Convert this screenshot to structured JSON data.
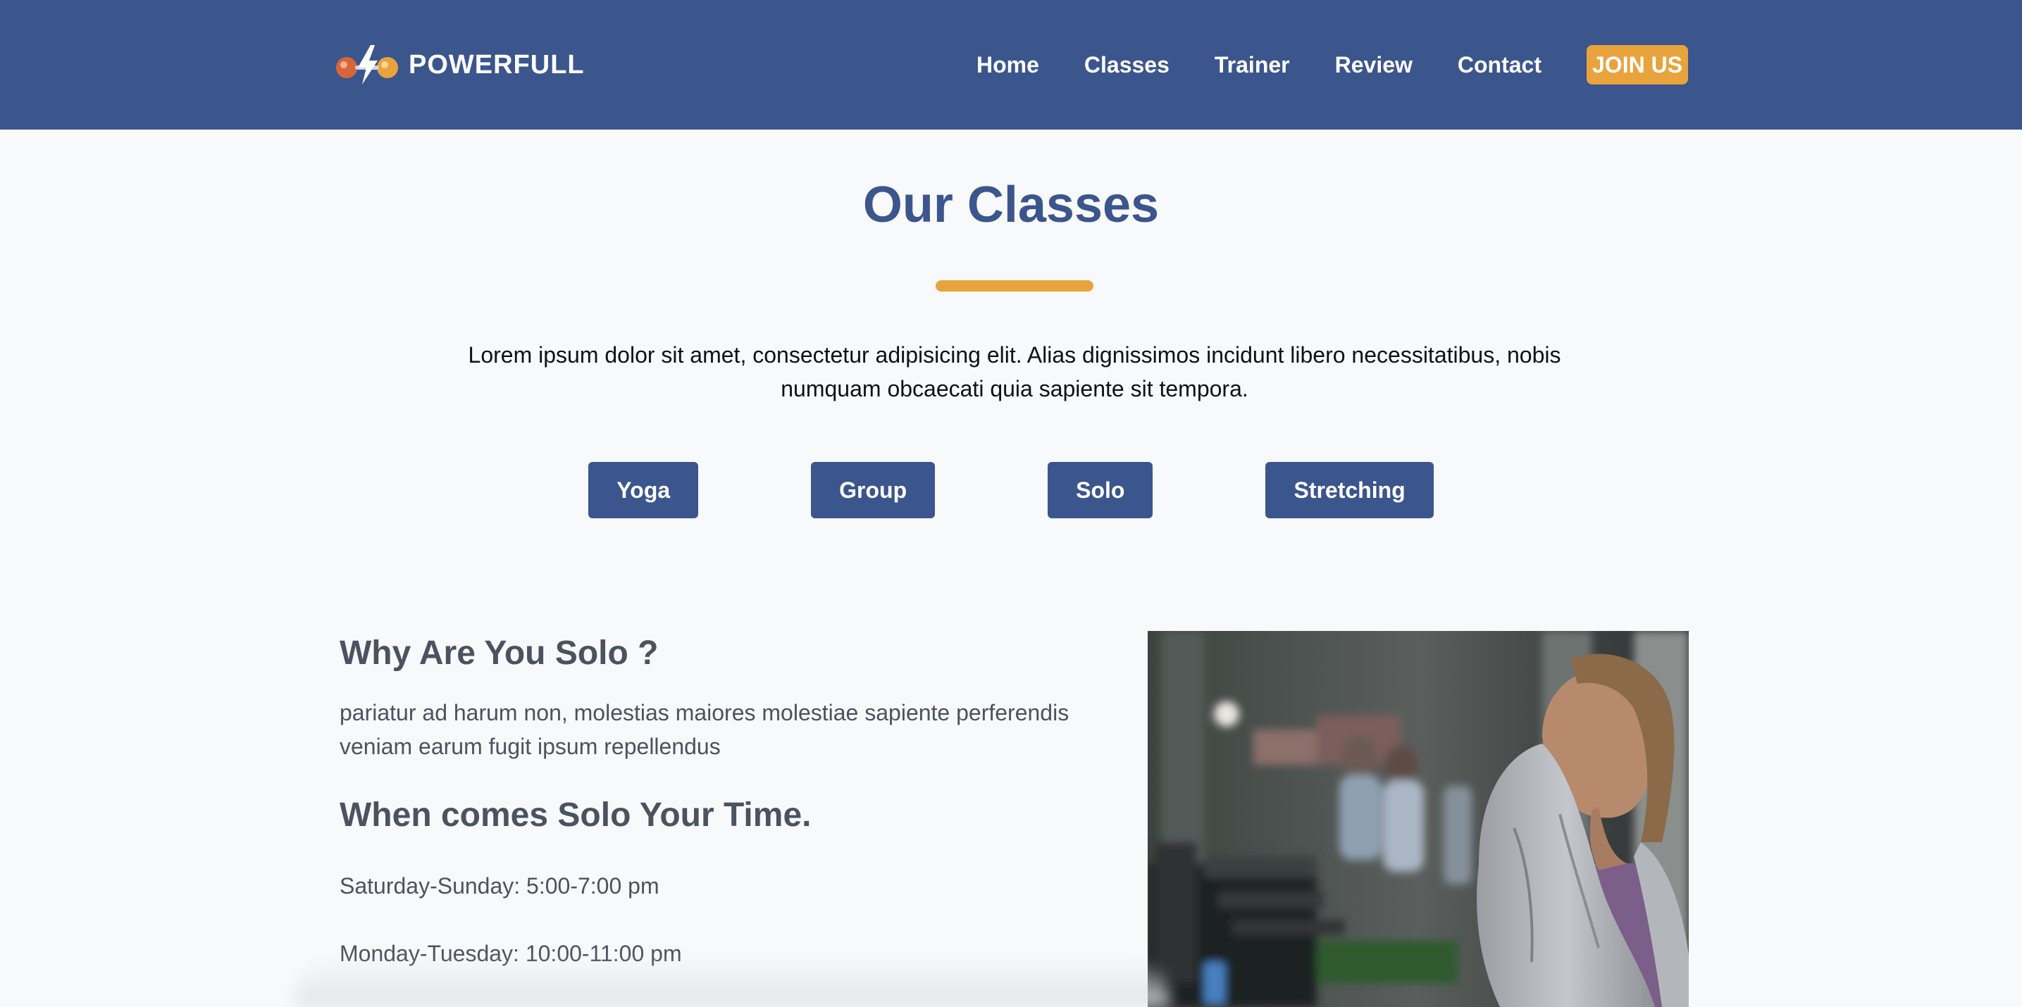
{
  "brand": {
    "name": "POWERFULL",
    "logo_icon": "dumbbell-lightning-icon"
  },
  "nav": {
    "links": [
      "Home",
      "Classes",
      "Trainer",
      "Review",
      "Contact"
    ],
    "cta": "JOIN US"
  },
  "classes": {
    "title": "Our Classes",
    "intro": "Lorem ipsum dolor sit amet, consectetur adipisicing elit. Alias dignissimos incidunt libero necessitatibus, nobis numquam obcaecati quia sapiente sit tempora.",
    "filters": [
      "Yoga",
      "Group",
      "Solo",
      "Stretching"
    ]
  },
  "detail": {
    "heading": "Why Are You Solo ?",
    "description": "pariatur ad harum non, molestias maiores molestiae sapiente perferendis veniam earum fugit ipsum repellendus",
    "schedule_heading": "When comes Solo Your Time.",
    "schedule": [
      "Saturday-Sunday: 5:00-7:00 pm",
      "Monday-Tuesday: 10:00-11:00 pm"
    ]
  },
  "colors": {
    "primary": "#3b558d",
    "accent": "#e8a33d",
    "background": "#f8f9fa",
    "text_dark": "#4b5260"
  }
}
